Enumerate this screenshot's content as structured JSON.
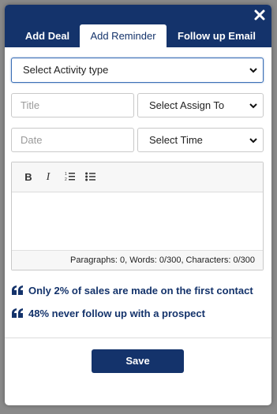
{
  "tabs": {
    "add_deal": "Add Deal",
    "add_reminder": "Add Reminder",
    "follow_up_email": "Follow up Email"
  },
  "form": {
    "activity_type": "Select Activity type",
    "title_placeholder": "Title",
    "assign_to": "Select Assign To",
    "date_placeholder": "Date",
    "time": "Select Time"
  },
  "editor": {
    "bold_label": "B",
    "italic_label": "I",
    "status": "Paragraphs: 0, Words: 0/300, Characters: 0/300"
  },
  "quotes": [
    "Only 2% of sales are made on the first contact",
    "48% never follow up with a prospect"
  ],
  "footer": {
    "save_label": "Save"
  },
  "icons": [
    "close-icon",
    "chevron-down-icon",
    "ordered-list-icon",
    "unordered-list-icon",
    "quote-icon"
  ],
  "colors": {
    "brand": "#14336b",
    "focus": "#3b6fb6"
  }
}
